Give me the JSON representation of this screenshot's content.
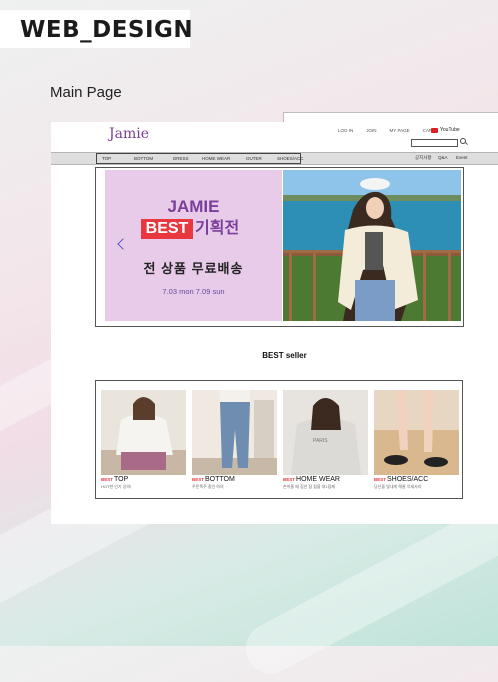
{
  "heading": "WEB_DESIGN",
  "section_label": "Main Page",
  "site": {
    "logo": "Jamie",
    "top_links": [
      "LOG IN",
      "JOIN",
      "MY PAGE",
      "CART"
    ],
    "youtube_label": "YouTube",
    "nav_items": [
      "TOP",
      "BOTTOM",
      "DRESS",
      "HOME WEAR",
      "OUTER",
      "SHOES/ACC"
    ],
    "right_nav": [
      "공지사항",
      "Q&A",
      "Event"
    ]
  },
  "banner": {
    "brand": "JAMIE",
    "best_label": "BEST",
    "plan_label": "기획전",
    "subtitle": "전 상품 무료배송",
    "dates": "7.03 mon 7.09 sun"
  },
  "best_seller": {
    "title": "BEST seller",
    "best_tag": "BEST",
    "items": [
      {
        "name": "TOP",
        "desc": "HOT한 인기 상의!"
      },
      {
        "name": "BOTTOM",
        "desc": "주문폭주 중인 하의"
      },
      {
        "name": "HOME WEAR",
        "desc": "손쉬울 때 집안 잠 잠을 대1잠제"
      },
      {
        "name": "SHOES/ACC",
        "desc": "당신을 빛내게 해줄 악세사리"
      }
    ]
  },
  "colors": {
    "accent": "#e8373f",
    "brand": "#7a3f9a",
    "banner_bg": "#e7cbe9"
  }
}
